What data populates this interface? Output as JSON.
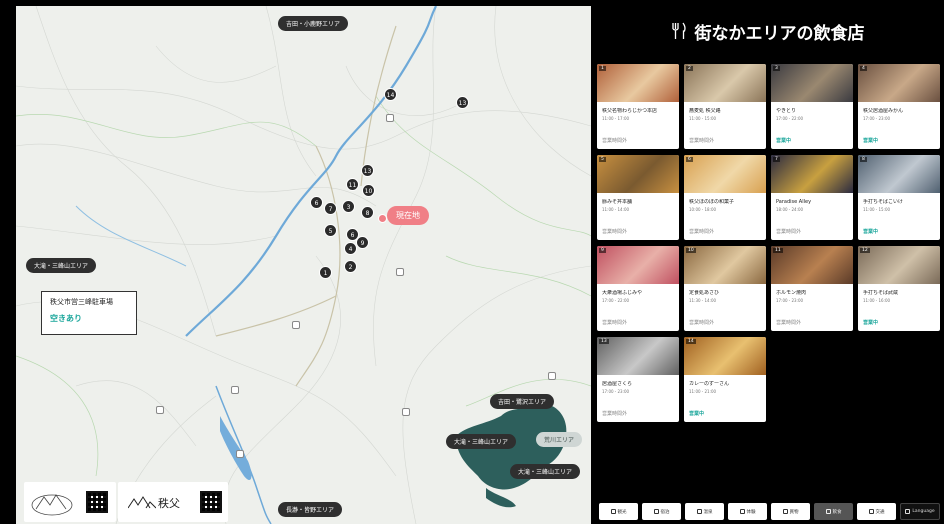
{
  "header": {
    "title": "街なかエリアの飲食店",
    "icon": "fork-knife-icon"
  },
  "map": {
    "areas": {
      "north": "吉田・小鹿野エリア",
      "west": "大滝・三峰山エリア",
      "east1": "吉田・鷺沢エリア",
      "east2": "大滝・三峰山エリア",
      "east3": "荒川エリア",
      "east4": "大滝・三峰山エリア",
      "south": "長瀞・皆野エリア"
    },
    "here_label": "現在地",
    "parking": {
      "name": "秩父市営三峰駐車場",
      "status": "空きあり"
    },
    "markers": [
      "1",
      "2",
      "3",
      "4",
      "5",
      "6",
      "7",
      "8",
      "9",
      "10",
      "11",
      "12",
      "13",
      "14"
    ],
    "logo_text": "秩父",
    "colors": {
      "accent": "#1aa69b",
      "here": "#f07f86",
      "area": "#2d5f5c"
    }
  },
  "restaurants": [
    {
      "num": "1",
      "name": "秩父名物わらじかつ本店",
      "hours": "11:00 - 17:00",
      "status": "営業時間外"
    },
    {
      "num": "2",
      "name": "蕎麦処 秩父路",
      "hours": "11:00 - 15:00",
      "status": "営業時間外"
    },
    {
      "num": "3",
      "name": "やきとり",
      "hours": "17:00 - 22:00",
      "status": "営業中"
    },
    {
      "num": "4",
      "name": "秩父居酒屋みかん",
      "hours": "17:00 - 23:00",
      "status": "営業中"
    },
    {
      "num": "5",
      "name": "豚みそ丼本舗",
      "hours": "11:00 - 14:00",
      "status": "営業時間外"
    },
    {
      "num": "6",
      "name": "秩父ほのぼの和菓子",
      "hours": "10:00 - 18:00",
      "status": "営業時間外"
    },
    {
      "num": "7",
      "name": "Paradise Alley",
      "hours": "18:00 - 24:00",
      "status": "営業時間外"
    },
    {
      "num": "8",
      "name": "手打ちそばこいけ",
      "hours": "11:00 - 15:00",
      "status": "営業中"
    },
    {
      "num": "9",
      "name": "大衆酒場ふじみや",
      "hours": "17:00 - 22:00",
      "status": "営業時間外"
    },
    {
      "num": "10",
      "name": "定食処あさひ",
      "hours": "11:30 - 14:00",
      "status": "営業時間外"
    },
    {
      "num": "11",
      "name": "ホルモン焼肉",
      "hours": "17:00 - 23:00",
      "status": "営業時間外"
    },
    {
      "num": "12",
      "name": "手打ちそば武蔵",
      "hours": "11:00 - 16:00",
      "status": "営業中"
    },
    {
      "num": "13",
      "name": "居酒屋さくら",
      "hours": "17:00 - 23:00",
      "status": "営業時間外"
    },
    {
      "num": "14",
      "name": "カレーのずーさん",
      "hours": "11:00 - 21:00",
      "status": "営業中"
    }
  ],
  "nav": [
    {
      "label": "観光",
      "state": "normal"
    },
    {
      "label": "宿泊",
      "state": "normal"
    },
    {
      "label": "温泉",
      "state": "normal"
    },
    {
      "label": "体験",
      "state": "normal"
    },
    {
      "label": "買物",
      "state": "normal"
    },
    {
      "label": "飲食",
      "state": "active"
    },
    {
      "label": "交通",
      "state": "normal"
    },
    {
      "label": "Language",
      "state": "dark"
    }
  ]
}
